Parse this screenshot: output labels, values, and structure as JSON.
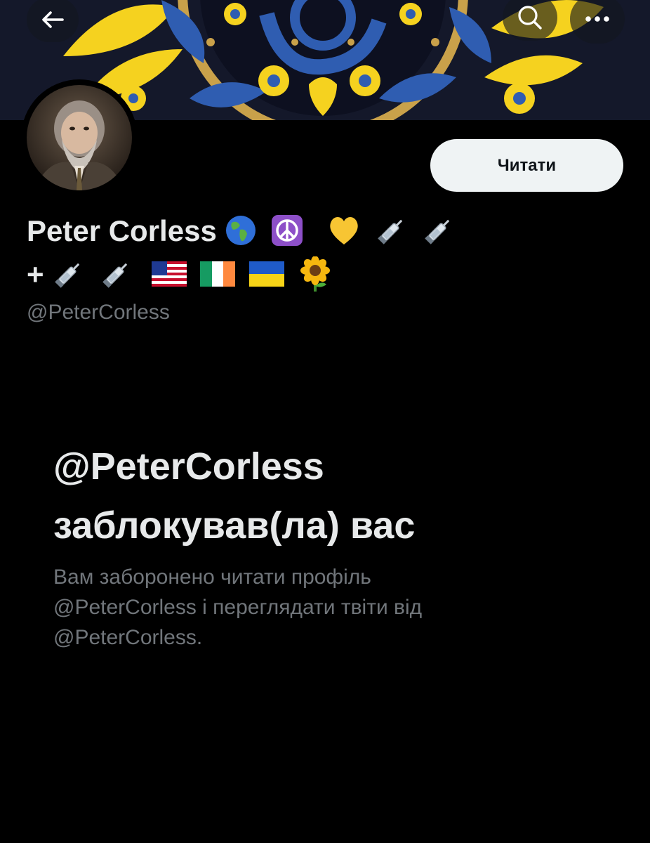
{
  "header": {
    "back_icon": "arrow-left-icon",
    "search_icon": "search-icon",
    "more_icon": "more-horizontal-icon"
  },
  "banner": {
    "colors": {
      "background": "#14182a",
      "yellow": "#f5d21f",
      "blue": "#2f5db1",
      "gold": "#c9a14a"
    }
  },
  "profile": {
    "display_name_text": "Peter Corless",
    "display_name_emojis_line1": [
      "globe-americas",
      "peace-symbol",
      "yellow-heart",
      "syringe",
      "syringe"
    ],
    "display_name_line2_prefix": "+",
    "display_name_emojis_line2": [
      "syringe",
      "syringe",
      "flag-us",
      "flag-ireland",
      "flag-ukraine",
      "sunflower"
    ],
    "handle": "@PeterCorless"
  },
  "actions": {
    "follow_label": "Читати"
  },
  "blocked": {
    "title_line1": "@PeterCorless",
    "title_line2": "заблокував(ла) вас",
    "desc_line1": "Вам заборонено читати профіль",
    "desc_line2": "@PeterCorless і переглядати твіти від",
    "desc_line3": "@PeterCorless."
  },
  "colors": {
    "page_bg": "#000000",
    "text_primary": "#e7e9ea",
    "text_secondary": "#71767b",
    "button_bg": "#eff3f4",
    "button_text": "#0f1419"
  }
}
